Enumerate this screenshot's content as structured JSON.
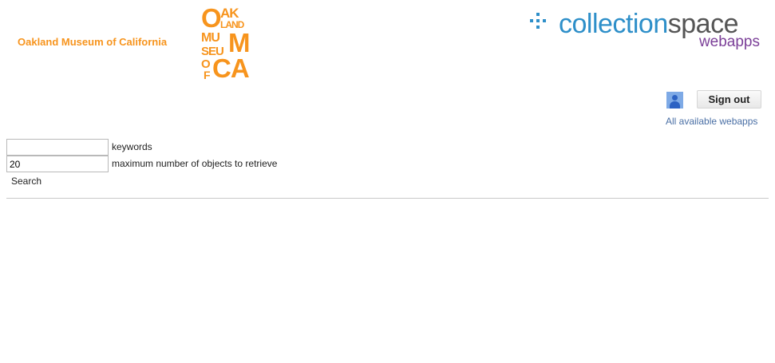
{
  "header": {
    "museum_name": "Oakland Museum of California",
    "omca_logo": {
      "line1_big": "O",
      "line1_small": "AK",
      "line2_small": "LAND",
      "line3_small": "MU",
      "line3_big": "M",
      "line4_small": "SEU",
      "line5_small_o": "O",
      "line6_small_f": "F",
      "line5_big": "CA"
    },
    "collectionspace": {
      "word_part1": "collection",
      "word_part2": "space",
      "subtitle": "webapps",
      "brand_color": "#2e8fc9",
      "subtitle_color": "#7b3f98"
    }
  },
  "user": {
    "icon": "user-avatar-icon",
    "sign_out_label": "Sign out",
    "all_webapps_link": "All available webapps"
  },
  "search_form": {
    "keywords": {
      "value": "",
      "label": "keywords"
    },
    "max_objects": {
      "value": "20",
      "label": "maximum number of objects to retrieve"
    },
    "search_button_label": "Search"
  },
  "colors": {
    "accent_orange": "#f7941d",
    "link_blue": "#4a6fa5"
  }
}
